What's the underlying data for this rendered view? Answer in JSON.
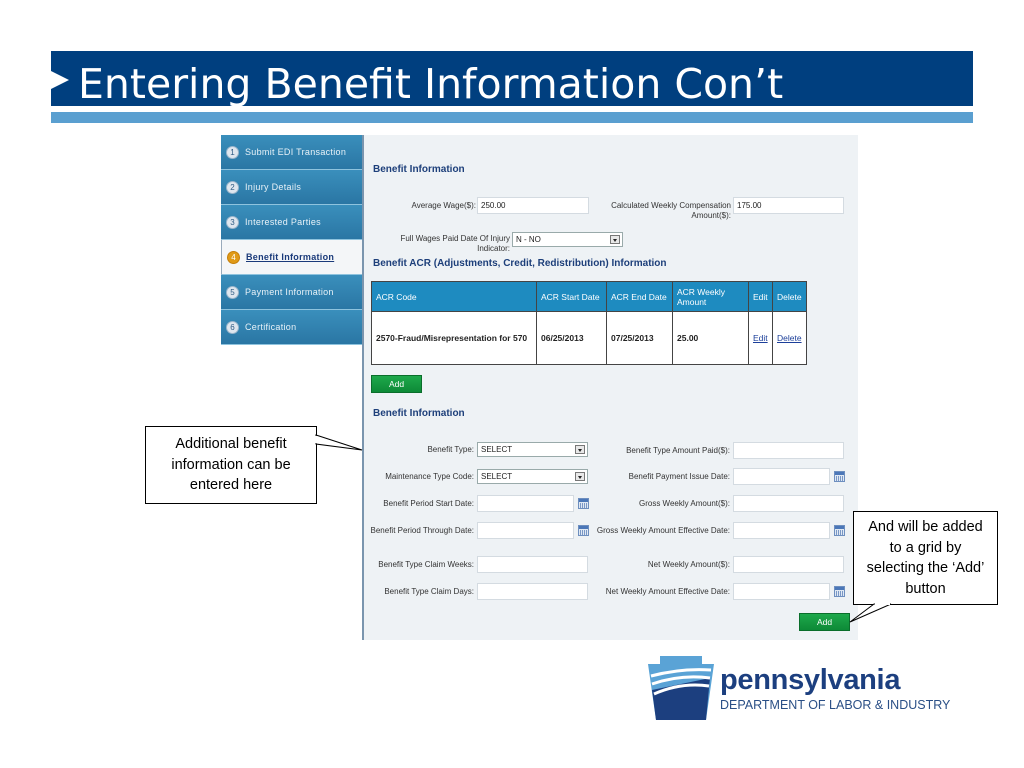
{
  "slide": {
    "title": "Entering Benefit Information Con’t"
  },
  "sidebar": {
    "items": [
      {
        "num": "1",
        "label": "Submit EDI Transaction",
        "active": false
      },
      {
        "num": "2",
        "label": "Injury Details",
        "active": false
      },
      {
        "num": "3",
        "label": "Interested Parties",
        "active": false
      },
      {
        "num": "4",
        "label": "Benefit Information",
        "active": true
      },
      {
        "num": "5",
        "label": "Payment Information",
        "active": false
      },
      {
        "num": "6",
        "label": "Certification",
        "active": false
      }
    ]
  },
  "benefit_info": {
    "heading": "Benefit Information",
    "average_wage_label": "Average Wage($):",
    "average_wage_value": "250.00",
    "calc_weekly_label": "Calculated Weekly Compensation Amount($):",
    "calc_weekly_value": "175.00",
    "full_wages_label": "Full Wages Paid Date Of Injury Indicator:",
    "full_wages_value": "N - NO"
  },
  "acr": {
    "heading": "Benefit ACR (Adjustments, Credit, Redistribution) Information",
    "columns": [
      "ACR Code",
      "ACR Start Date",
      "ACR End Date",
      "ACR Weekly Amount",
      "Edit",
      "Delete"
    ],
    "rows": [
      {
        "code": "2570-Fraud/Misrepresentation for 570",
        "start": "06/25/2013",
        "end": "07/25/2013",
        "amount": "25.00",
        "edit": "Edit",
        "delete": "Delete"
      }
    ],
    "add_label": "Add"
  },
  "benefit_form": {
    "heading": "Benefit Information",
    "benefit_type_label": "Benefit Type:",
    "benefit_type_value": "SELECT",
    "maintenance_type_label": "Maintenance Type Code:",
    "maintenance_type_value": "SELECT",
    "period_start_label": "Benefit Period Start Date:",
    "period_through_label": "Benefit Period Through Date:",
    "claim_weeks_label": "Benefit Type Claim Weeks:",
    "claim_days_label": "Benefit Type Claim Days:",
    "amount_paid_label": "Benefit Type Amount Paid($):",
    "payment_issue_label": "Benefit Payment Issue Date:",
    "gross_weekly_label": "Gross Weekly Amount($):",
    "gross_weekly_eff_label": "Gross Weekly Amount Effective Date:",
    "net_weekly_label": "Net Weekly Amount($):",
    "net_weekly_eff_label": "Net Weekly Amount Effective Date:",
    "add_label": "Add"
  },
  "callouts": {
    "left": "Additional benefit information can be entered here",
    "right": "And will be added to a grid by selecting the ‘Add’ button"
  },
  "logo": {
    "word": "pennsylvania",
    "dept": "DEPARTMENT OF LABOR & INDUSTRY"
  },
  "colors": {
    "title_bar": "#003f7f",
    "stripe": "#5a9fd0",
    "table_header": "#1e8bc0",
    "add_button": "#129440",
    "active_step": "#e09a17"
  }
}
